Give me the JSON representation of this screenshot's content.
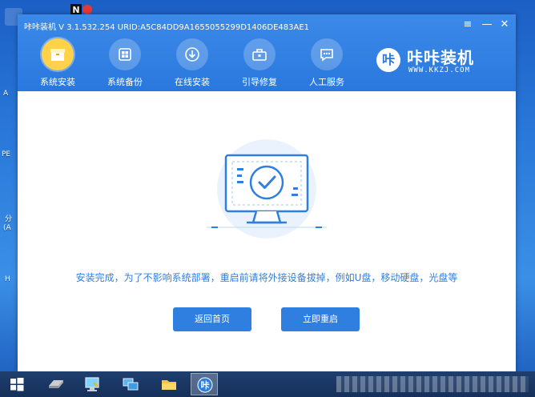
{
  "window": {
    "title": "咔咔装机 V 3.1.532.254 URID:A5C84DD9A1655055299D1406DE483AE1",
    "controls": {
      "menu": "≡",
      "minimize": "—",
      "close": "✕"
    }
  },
  "nav": {
    "items": [
      {
        "label": "系统安装",
        "icon": "box-icon",
        "active": true
      },
      {
        "label": "系统备份",
        "icon": "backup-icon",
        "active": false
      },
      {
        "label": "在线安装",
        "icon": "download-icon",
        "active": false
      },
      {
        "label": "引导修复",
        "icon": "toolbox-icon",
        "active": false
      },
      {
        "label": "人工服务",
        "icon": "chat-icon",
        "active": false
      }
    ]
  },
  "brand": {
    "logo_char": "咔",
    "name": "咔咔装机",
    "url": "WWW.KKZJ.COM"
  },
  "main": {
    "message": "安装完成，为了不影响系统部署，重启前请将外接设备拔掉，例如U盘，移动硬盘，光盘等",
    "buttons": {
      "back": "返回首页",
      "restart": "立即重启"
    }
  },
  "desktop": {
    "labels": [
      "A",
      "PE",
      "分",
      "(A",
      "H"
    ]
  },
  "taskbar": {
    "active_app_char": "咔"
  },
  "colors": {
    "accent": "#2f7fe0",
    "header": "#2a78de",
    "active_nav": "#ffd24a",
    "badge_red": "#e53935"
  }
}
